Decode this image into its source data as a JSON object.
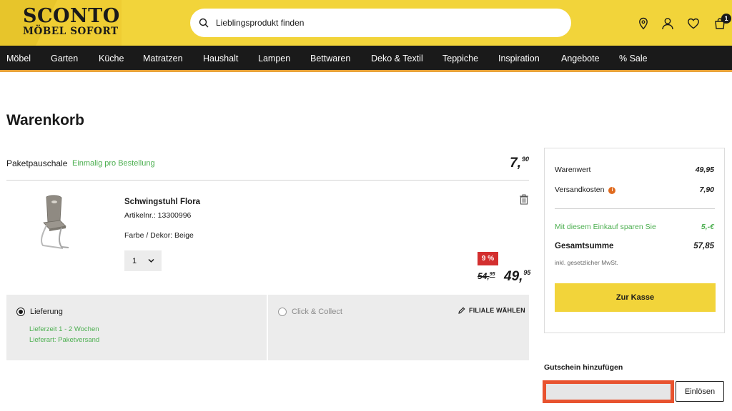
{
  "header": {
    "logo_top": "SCONTO",
    "logo_bottom": "MÖBEL SOFORT",
    "search_placeholder": "Lieblingsprodukt finden",
    "cart_count": "1",
    "icons": [
      "map-pin-icon",
      "user-icon",
      "heart-icon",
      "cart-icon"
    ]
  },
  "nav": {
    "items": [
      "Möbel",
      "Garten",
      "Küche",
      "Matratzen",
      "Haushalt",
      "Lampen",
      "Bettwaren",
      "Deko & Textil",
      "Teppiche",
      "Inspiration",
      "Angebote",
      "% Sale"
    ]
  },
  "cart": {
    "title": "Warenkorb",
    "shipping_fee": {
      "label": "Paketpauschale",
      "note": "Einmalig pro Bestellung",
      "price_main": "7,",
      "price_cents": "90"
    },
    "item": {
      "name": "Schwingstuhl Flora",
      "article": "Artikelnr.: 13300996",
      "color": "Farbe / Dekor: Beige",
      "quantity": "1",
      "discount": "9 %",
      "old_price_main": "54,",
      "old_price_cents": "95",
      "price_main": "49,",
      "price_cents": "95"
    },
    "delivery": {
      "option1_label": "Lieferung",
      "option1_selected": true,
      "lieferzeit": "Lieferzeit 1 - 2 Wochen",
      "lieferart": "Lieferart: Paketversand",
      "option2_label": "Click & Collect",
      "option2_selected": false,
      "store_link": "FILIALE WÄHLEN"
    }
  },
  "summary": {
    "warenwert_label": "Warenwert",
    "warenwert_value": "49,95",
    "versand_label": "Versandkosten",
    "versand_value": "7,90",
    "savings_label": "Mit diesem Einkauf sparen Sie",
    "savings_value": "5,-€",
    "total_label": "Gesamtsumme",
    "total_value": "57,85",
    "tax_note": "inkl. gesetzlicher MwSt.",
    "checkout_label": "Zur Kasse"
  },
  "voucher": {
    "title": "Gutschein hinzufügen",
    "input_value": "",
    "button_label": "Einlösen"
  },
  "colors": {
    "brand_yellow": "#f2d43a",
    "nav_bg": "#1a1a1a",
    "accent_green": "#4caf50",
    "discount_red": "#d32f2f",
    "highlight_orange": "#e8532f"
  }
}
